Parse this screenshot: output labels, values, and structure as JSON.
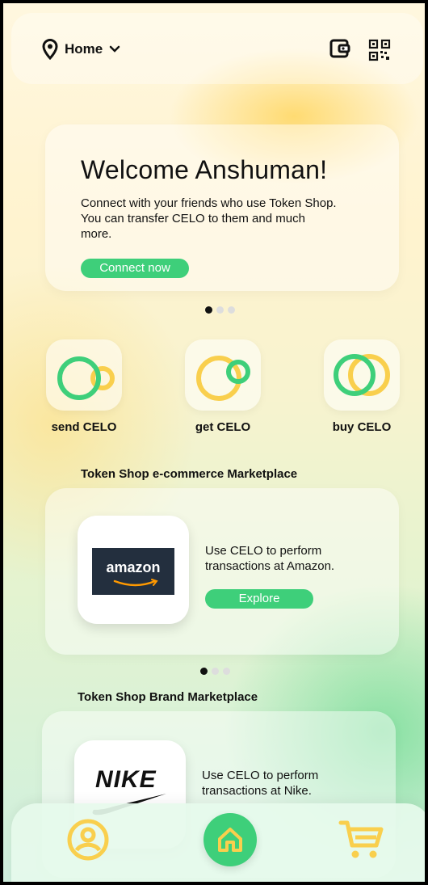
{
  "header": {
    "location": "Home",
    "icons": [
      "location-pin-icon",
      "chevron-down-icon",
      "wallet-icon",
      "qr-code-icon"
    ]
  },
  "welcome": {
    "title": "Welcome Anshuman!",
    "body": "Connect with your friends who use Token Shop. You can transfer CELO to them and much more.",
    "cta": "Connect now"
  },
  "actions": [
    {
      "label": "send CELO",
      "icon": "send-celo-icon"
    },
    {
      "label": "get CELO",
      "icon": "get-celo-icon"
    },
    {
      "label": "buy CELO",
      "icon": "buy-celo-icon"
    }
  ],
  "ecommerce": {
    "title": "Token Shop e-commerce Marketplace",
    "card": {
      "logo_text": "amazon",
      "text": "Use CELO to perform transactions at Amazon.",
      "cta": "Explore"
    }
  },
  "brand": {
    "title": "Token Shop Brand Marketplace",
    "card": {
      "logo_text": "NIKE",
      "text": "Use CELO to perform transactions at Nike."
    }
  },
  "nav": [
    "profile-icon",
    "home-icon",
    "cart-icon"
  ],
  "colors": {
    "accent_green": "#3ecf7a",
    "accent_yellow": "#f9cf4d"
  }
}
